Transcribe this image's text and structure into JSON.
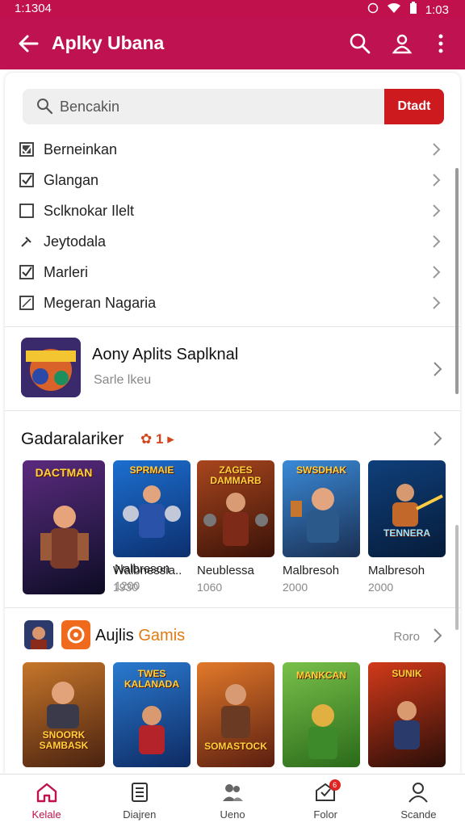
{
  "status_bar": {
    "time": "1:1304",
    "right_text": "1:03"
  },
  "app_bar": {
    "title": "Aplky Ubana"
  },
  "search": {
    "placeholder": "Bencakin",
    "button_label": "Dtadt"
  },
  "filters": [
    {
      "label": "Berneinkan",
      "checked": true
    },
    {
      "label": "Glangan",
      "checked": true
    },
    {
      "label": "Sclknokar Ilelt",
      "checked": false
    },
    {
      "label": "Jeytodala",
      "checked": false
    },
    {
      "label": "Marleri",
      "checked": true
    },
    {
      "label": "Megeran Nagaria",
      "checked": false
    }
  ],
  "featured": {
    "title": "Aony Aplits Saplknal",
    "subtitle": "Sarle lkeu"
  },
  "section1": {
    "title": "Gadaralariker",
    "badge": "1",
    "games": [
      {
        "name": "Nalbreson",
        "sub": "1200",
        "cover_text": "DACTMAN"
      },
      {
        "name": "Walbnessia..",
        "sub": "1930",
        "cover_text": "SPRMAIE"
      },
      {
        "name": "Neublessa",
        "sub": "1060",
        "cover_text": "ZAGES DAMMARB"
      },
      {
        "name": "Malbresoh",
        "sub": "2000",
        "cover_text": "SWSDHAK"
      },
      {
        "name": "Malbresoh",
        "sub": "2000",
        "cover_text": "TENNERA"
      }
    ]
  },
  "section2": {
    "title_part1": "Aujlis",
    "title_part2": "Gamis",
    "more_label": "Roro",
    "games": [
      {
        "cover_text": "SNOORK SAMBASK"
      },
      {
        "cover_text": "TWES KALANADA"
      },
      {
        "cover_text": "SOMASTOCK"
      },
      {
        "cover_text": "MANKCAN"
      },
      {
        "cover_text": "SUNIK"
      }
    ]
  },
  "bottom_nav": [
    {
      "label": "Kelale",
      "icon": "home-icon",
      "active": true
    },
    {
      "label": "Diajren",
      "icon": "document-icon",
      "active": false
    },
    {
      "label": "Ueno",
      "icon": "group-icon",
      "active": false
    },
    {
      "label": "Folor",
      "icon": "inbox-icon",
      "active": false,
      "badge": "6"
    },
    {
      "label": "Scande",
      "icon": "profile-icon",
      "active": false
    }
  ],
  "colors": {
    "brand": "#bf1250",
    "accent_button": "#cc1a1f",
    "section_accent": "#e07a12"
  }
}
